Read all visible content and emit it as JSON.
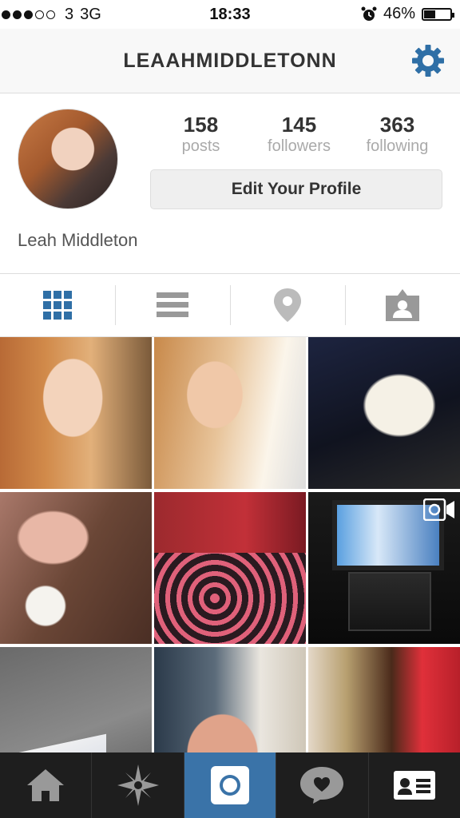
{
  "status_bar": {
    "carrier": "3",
    "network": "3G",
    "time": "18:33",
    "battery": "46%",
    "battery_level": 0.46
  },
  "header": {
    "username": "LEAAHMIDDLETONN"
  },
  "profile": {
    "full_name": "Leah Middleton",
    "stats": [
      {
        "value": "158",
        "label": "posts"
      },
      {
        "value": "145",
        "label": "followers"
      },
      {
        "value": "363",
        "label": "following"
      }
    ],
    "edit_button": "Edit Your Profile"
  },
  "view_tabs": [
    "grid-icon",
    "list-icon",
    "map-pin-icon",
    "tagged-photos-icon"
  ],
  "photos": [
    "selfie",
    "selfie-pout",
    "white-dog",
    "woman-with-rabbit",
    "bedroom",
    "television",
    "letter-on-ground",
    "man-with-glasses",
    "door-handle"
  ],
  "bottom_nav": [
    "home-icon",
    "explore-icon",
    "camera-icon",
    "news-icon",
    "profile-icon"
  ],
  "colors": {
    "accent": "#3a73a8",
    "nav_bg": "#1e1e1e",
    "icon_gray": "#999999"
  }
}
